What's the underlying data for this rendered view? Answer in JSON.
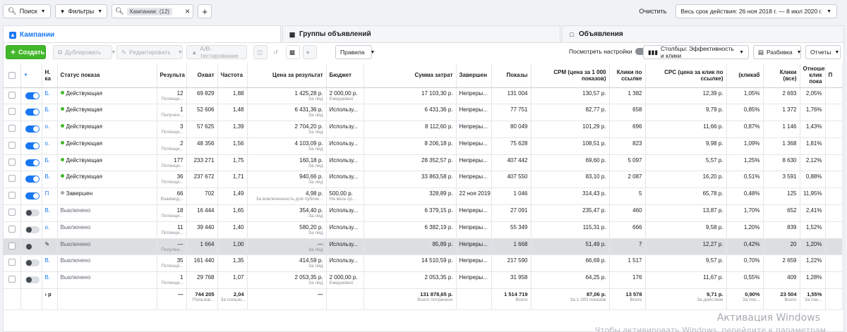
{
  "topbar": {
    "search_label": "Поиск",
    "filters_label": "Фильтры",
    "chip_label": "Кампании:",
    "chip_count": "(12)",
    "clear_label": "Очистить",
    "date_range": "Весь срок действия: 26 ноя 2018 г. — 8 июл 2020 г."
  },
  "tabs": {
    "campaigns": "Кампании",
    "adsets": "Группы объявлений",
    "ads": "Объявления"
  },
  "toolbar": {
    "create": "Создать",
    "duplicate": "Дублировать",
    "edit": "Редактировать",
    "ab_test": "A/B-тестирование",
    "rules": "Правила",
    "view_settings": "Посмотреть настройки",
    "columns": "Столбцы: Эффективность и клики",
    "breakdown": "Разбивка",
    "reports": "Отчеты"
  },
  "table": {
    "headers": {
      "name": "Н. ка",
      "status": "Статус показа",
      "results": "Результа",
      "reach": "Охват",
      "frequency": "Частота",
      "cost_per_result": "Цена за результат",
      "budget": "Бюджет",
      "amount_spent": "Сумма затрат",
      "ends": "Завершен",
      "impressions": "Показы",
      "cpm": "CPM (цена за 1 000 показов)",
      "link_clicks": "Клики по ссылке",
      "cpc": "CPC (цена за клик по ссылке)",
      "ctr": "(кликаб",
      "clicks_all": "Клики (все)",
      "ratio": "Отноше клик пока",
      "extra": "П"
    },
    "rows": [
      {
        "name": "Б.",
        "status": "Действующая",
        "status_kind": "active",
        "toggle": "on",
        "results": "12",
        "results_sub": "Потенци...",
        "reach": "69 829",
        "freq": "1,88",
        "cpr": "1 425,28 р.",
        "cpr_sub": "За лид",
        "budget": "2 000,00 р.",
        "budget_sub": "Ежедневно",
        "spent": "17 103,30 р.",
        "ends": "Непреры...",
        "impr": "131 004",
        "cpm": "130,57 р.",
        "lclicks": "1 382",
        "cpc": "12,39 р.",
        "ctr": "1,05%",
        "clicks": "2 693",
        "ratio": "2,05%"
      },
      {
        "name": "Б.",
        "status": "Действующая",
        "status_kind": "active",
        "toggle": "on",
        "results": "1",
        "results_sub": "Получен...",
        "reach": "52 606",
        "freq": "1,48",
        "cpr": "6 431,36 р.",
        "cpr_sub": "За лид",
        "budget": "Использу...",
        "budget_sub": "",
        "spent": "6 431,36 р.",
        "ends": "Непреры...",
        "impr": "77 751",
        "cpm": "82,77 р.",
        "lclicks": "658",
        "cpc": "9,79 р.",
        "ctr": "0,85%",
        "clicks": "1 372",
        "ratio": "1,76%"
      },
      {
        "name": "о.",
        "status": "Действующая",
        "status_kind": "active",
        "toggle": "on",
        "results": "3",
        "results_sub": "Потенци...",
        "reach": "57 625",
        "freq": "1,39",
        "cpr": "2 704,20 р.",
        "cpr_sub": "За лид",
        "budget": "Использу...",
        "budget_sub": "",
        "spent": "8 112,60 р.",
        "ends": "Непреры...",
        "impr": "80 049",
        "cpm": "101,29 р.",
        "lclicks": "696",
        "cpc": "11,66 р.",
        "ctr": "0,87%",
        "clicks": "1 146",
        "ratio": "1,43%"
      },
      {
        "name": "о.",
        "status": "Действующая",
        "status_kind": "active",
        "toggle": "on",
        "results": "2",
        "results_sub": "Потенци...",
        "reach": "48 356",
        "freq": "1,56",
        "cpr": "4 103,09 р.",
        "cpr_sub": "За лид",
        "budget": "Использу...",
        "budget_sub": "",
        "spent": "8 206,18 р.",
        "ends": "Непреры...",
        "impr": "75 628",
        "cpm": "108,51 р.",
        "lclicks": "823",
        "cpc": "9,98 р.",
        "ctr": "1,09%",
        "clicks": "1 368",
        "ratio": "1,81%"
      },
      {
        "name": "Б.",
        "status": "Действующая",
        "status_kind": "active",
        "toggle": "on",
        "results": "177",
        "results_sub": "Потенци...",
        "reach": "233 271",
        "freq": "1,75",
        "cpr": "160,18 р.",
        "cpr_sub": "За лид",
        "budget": "Использу...",
        "budget_sub": "",
        "spent": "28 352,57 р.",
        "ends": "Непреры...",
        "impr": "407 442",
        "cpm": "69,60 р.",
        "lclicks": "5 097",
        "cpc": "5,57 р.",
        "ctr": "1,25%",
        "clicks": "8 630",
        "ratio": "2,12%"
      },
      {
        "name": "В.",
        "status": "Действующая",
        "status_kind": "active",
        "toggle": "on",
        "results": "36",
        "results_sub": "Потенци...",
        "reach": "237 672",
        "freq": "1,71",
        "cpr": "940,66 р.",
        "cpr_sub": "За лид",
        "budget": "Использу...",
        "budget_sub": "",
        "spent": "33 863,58 р.",
        "ends": "Непреры...",
        "impr": "407 550",
        "cpm": "83,10 р.",
        "lclicks": "2 087",
        "cpc": "16,20 р.",
        "ctr": "0,51%",
        "clicks": "3 591",
        "ratio": "0,88%"
      },
      {
        "name": "П",
        "status": "Завершен",
        "status_kind": "done",
        "toggle": "on",
        "results": "66",
        "results_sub": "Взаимод...",
        "reach": "702",
        "freq": "1,49",
        "cpr": "4,98 р.",
        "cpr_sub": "За вовлеченность для публик...",
        "budget": "500,00 р.",
        "budget_sub": "На весь ср...",
        "spent": "328,89 р.",
        "ends": "22 ноя 2019 г.",
        "impr": "1 046",
        "cpm": "314,43 р.",
        "lclicks": "5",
        "cpc": "65,78 р.",
        "ctr": "0,48%",
        "clicks": "125",
        "ratio": "11,95%"
      },
      {
        "name": "В.",
        "status": "Выключено",
        "status_kind": "off",
        "toggle": "off",
        "results": "18",
        "results_sub": "Потенци...",
        "reach": "16 444",
        "freq": "1,65",
        "cpr": "354,40 р.",
        "cpr_sub": "За лид",
        "budget": "Использу...",
        "budget_sub": "",
        "spent": "6 379,15 р.",
        "ends": "Непреры...",
        "impr": "27 091",
        "cpm": "235,47 р.",
        "lclicks": "460",
        "cpc": "13,87 р.",
        "ctr": "1,70%",
        "clicks": "652",
        "ratio": "2,41%"
      },
      {
        "name": "о.",
        "status": "Выключено",
        "status_kind": "off",
        "toggle": "off",
        "results": "11",
        "results_sub": "Потенци...",
        "reach": "39 440",
        "freq": "1,40",
        "cpr": "580,20 р.",
        "cpr_sub": "За лид",
        "budget": "Использу...",
        "budget_sub": "",
        "spent": "6 382,19 р.",
        "ends": "Непреры...",
        "impr": "55 349",
        "cpm": "115,31 р.",
        "lclicks": "666",
        "cpc": "9,58 р.",
        "ctr": "1,20%",
        "clicks": "839",
        "ratio": "1,52%"
      },
      {
        "name": "",
        "status": "Выключено",
        "status_kind": "off",
        "toggle": "off",
        "selected": true,
        "results": "—",
        "results_sub": "Получен...",
        "reach": "1 664",
        "freq": "1,00",
        "cpr": "—",
        "cpr_sub": "За лид",
        "budget": "Использу...",
        "budget_sub": "",
        "spent": "85,89 р.",
        "ends": "Непреры...",
        "impr": "1 668",
        "cpm": "51,49 р.",
        "lclicks": "7",
        "cpc": "12,27 р.",
        "ctr": "0,42%",
        "clicks": "20",
        "ratio": "1,20%"
      },
      {
        "name": "В.",
        "status": "Выключено",
        "status_kind": "off",
        "toggle": "off",
        "results": "35",
        "results_sub": "Потенци...",
        "reach": "161 440",
        "freq": "1,35",
        "cpr": "414,59 р.",
        "cpr_sub": "За лид",
        "budget": "Использу...",
        "budget_sub": "",
        "spent": "14 510,59 р.",
        "ends": "Непреры...",
        "impr": "217 590",
        "cpm": "66,69 р.",
        "lclicks": "1 517",
        "cpc": "9,57 р.",
        "ctr": "0,70%",
        "clicks": "2 659",
        "ratio": "1,22%"
      },
      {
        "name": "В.",
        "status": "Выключено",
        "status_kind": "off",
        "toggle": "off",
        "results": "1",
        "results_sub": "Потенци...",
        "reach": "29 768",
        "freq": "1,07",
        "cpr": "2 053,35 р.",
        "cpr_sub": "За лид",
        "budget": "2 000,00 р.",
        "budget_sub": "Ежедневно",
        "spent": "2 053,35 р.",
        "ends": "Непреры...",
        "impr": "31 958",
        "cpm": "64,25 р.",
        "lclicks": "176",
        "cpc": "11,67 р.",
        "ctr": "0,55%",
        "clicks": "409",
        "ratio": "1,28%"
      }
    ],
    "total": {
      "name": "› р",
      "results": "—",
      "reach": "744 205",
      "reach_sub": "Пользов...",
      "freq": "2,04",
      "freq_sub": "За пользо...",
      "cpr": "—",
      "budget": "",
      "spent": "131 878,65 р.",
      "spent_sub": "Всего потрачено",
      "ends": "",
      "impr": "1 514 719",
      "impr_sub": "Всего",
      "cpm": "87,06 р.",
      "cpm_sub": "За 1 000 показов",
      "lclicks": "13 578",
      "lclicks_sub": "Всего",
      "cpc": "9,71 р.",
      "cpc_sub": "За действие",
      "ctr": "0,90%",
      "ctr_sub": "За пок...",
      "clicks": "23 504",
      "clicks_sub": "Всего",
      "ratio": "1,55%",
      "ratio_sub": "За пок..."
    }
  },
  "watermark": {
    "title": "Активация Windows",
    "subtitle": "Чтобы активировать Windows, перейдите к параметрам"
  },
  "colors": {
    "accent": "#1877f2",
    "create_green": "#42b72a",
    "active_dot": "#42b72a"
  }
}
